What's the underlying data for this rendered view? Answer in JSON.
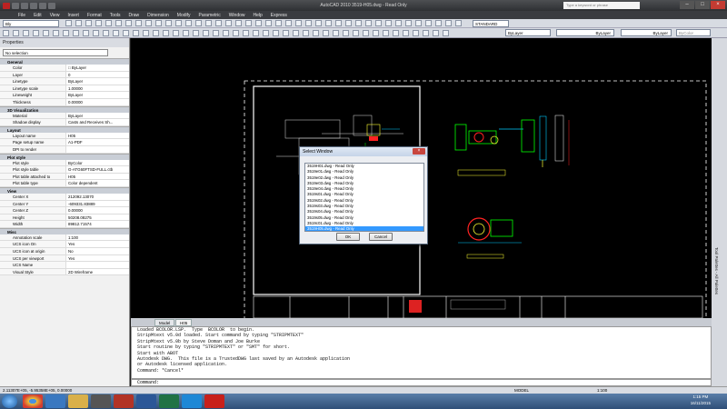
{
  "window": {
    "title": "AutoCAD 2010    3519-H05.dwg - Read Only",
    "search_placeholder": "Type a keyword or phrase"
  },
  "menu": [
    "File",
    "Edit",
    "View",
    "Insert",
    "Format",
    "Tools",
    "Draw",
    "Dimension",
    "Modify",
    "Parametric",
    "Window",
    "Help",
    "Express"
  ],
  "toolbar": {
    "workspace": "Bly",
    "style": "STANDARD",
    "layer": "ByLayer",
    "linetype": "ByLayer",
    "lineweight": "ByLayer",
    "color": "ByColor"
  },
  "properties": {
    "header": "Properties",
    "selection": "No selection",
    "sections": [
      {
        "title": "General",
        "rows": [
          [
            "Color",
            "□ ByLayer"
          ],
          [
            "Layer",
            "0"
          ],
          [
            "Linetype",
            "ByLayer"
          ],
          [
            "Linetype scale",
            "1.00000"
          ],
          [
            "Lineweight",
            "ByLayer"
          ],
          [
            "Thickness",
            "0.00000"
          ]
        ]
      },
      {
        "title": "3D Visualization",
        "rows": [
          [
            "Material",
            "ByLayer"
          ],
          [
            "Shadow display",
            "Casts and Receives Sh..."
          ]
        ]
      },
      {
        "title": "Layout",
        "rows": [
          [
            "Layout name",
            "H05"
          ],
          [
            "Page setup name",
            "A1-PDF"
          ],
          [
            "DPI to render",
            ""
          ]
        ]
      },
      {
        "title": "Plot style",
        "rows": [
          [
            "Plot style",
            "ByColor"
          ],
          [
            "Plot style table",
            "G-ATG60FTSD-FULL.ctb"
          ],
          [
            "Plot table attached to",
            "H05"
          ],
          [
            "Plot table type",
            "Color dependent"
          ]
        ]
      },
      {
        "title": "View",
        "rows": [
          [
            "Center X",
            "212092.13070"
          ],
          [
            "Center Y",
            "-609331.83889"
          ],
          [
            "Center Z",
            "0.00000"
          ],
          [
            "Height",
            "50208.08275"
          ],
          [
            "Width",
            "89812.71574"
          ]
        ]
      },
      {
        "title": "Misc",
        "rows": [
          [
            "Annotation scale",
            "1:100"
          ],
          [
            "UCS icon On",
            "Yes"
          ],
          [
            "UCS icon at origin",
            "No"
          ],
          [
            "UCS per viewport",
            "Yes"
          ],
          [
            "UCS Name",
            ""
          ],
          [
            "Visual Style",
            "2D Wireframe"
          ]
        ]
      }
    ]
  },
  "tabs": [
    "Model",
    "H05"
  ],
  "command_history": [
    "Loaded BCOLOR.LSP.  Type  BCOLOR  to begin.",
    "StripMtext v5.0d loaded. Start command by typing \"STRIPMTEXT\"",
    "StripMtext v5.0b by Steve Doman and Joe Burke",
    "Start routine by typing \"STRIPMTEXT\" or \"SMT\" for short.",
    "Start with ABOT",
    "Autodesk DWG.  This file is a TrustedDWG last saved by an Autodesk application",
    "or Autodesk licensed application.",
    "Command: *Cancel*"
  ],
  "command_prompt": "Command:",
  "status": {
    "coords": "2.11307E+05, -5.95358E+05, 0.00000",
    "space": "MODEL",
    "scale": "1:100"
  },
  "right_palette_label": "Tool Palettes - All Palettes",
  "dialog": {
    "title": "Select Window",
    "items": [
      "3519H01.dwg - Read Only",
      "3519e01.dwg - Read Only",
      "3519e02.dwg - Read Only",
      "3519e03.dwg - Read Only",
      "3519e04.dwg - Read Only",
      "3519s01.dwg - Read Only",
      "3519s02.dwg - Read Only",
      "3519s03.dwg - Read Only",
      "3519s04.dwg - Read Only",
      "3519s05.dwg - Read Only",
      "3519c01.dwg - Read Only",
      "3519H05.dwg - Read Only"
    ],
    "selected_index": 11,
    "ok": "OK",
    "cancel": "Cancel"
  },
  "clock": {
    "time": "1:15 PM",
    "date": "16/11/2015"
  },
  "colors": {
    "accent": "#3399ff",
    "canvas": "#000000",
    "cad_green": "#00d800",
    "cad_red": "#ff2020",
    "cad_cyan": "#00c8ff"
  }
}
